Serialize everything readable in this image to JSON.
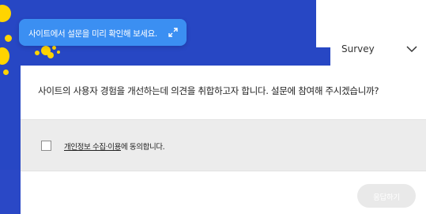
{
  "toast": {
    "text": "사이트에서 설문을 미리 확인해 보세요.",
    "icon": "expand-icon"
  },
  "survey": {
    "tab_label": "Survey",
    "question": "사이트의 사용자 경험을 개선하는데 의견을 취합하고자 합니다. 설문에 참여해 주시겠습니까?",
    "consent": {
      "link_text": "개인정보 수집·이용",
      "suffix": "에 동의합니다.",
      "checked": false
    },
    "submit_label": "응답하기"
  },
  "colors": {
    "backdrop": "#2747c4",
    "toast": "#3b8ff2",
    "accent_yellow": "#ffd400",
    "consent_bg": "#ececec",
    "submit_disabled": "#e9e9e9"
  }
}
